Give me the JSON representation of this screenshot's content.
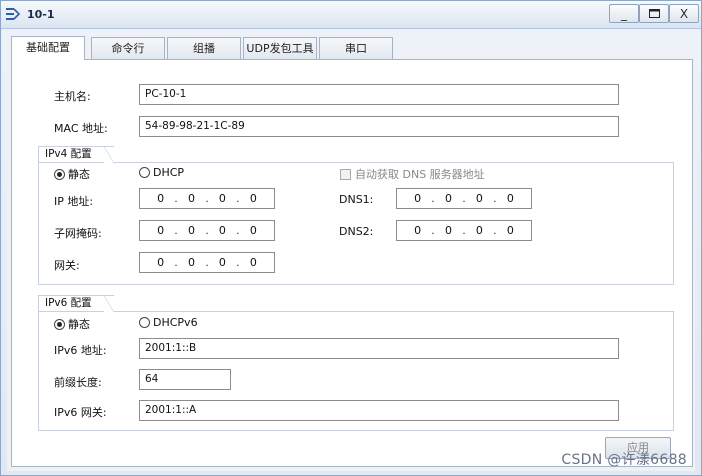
{
  "window": {
    "title": "10-1"
  },
  "tabs": [
    "基础配置",
    "命令行",
    "组播",
    "UDP发包工具",
    "串口"
  ],
  "basic": {
    "hostname_label": "主机名:",
    "hostname_value": "PC-10-1",
    "mac_label": "MAC 地址:",
    "mac_value": "54-89-98-21-1C-89"
  },
  "ipv4": {
    "section_title": "IPv4 配置",
    "static_label": "静态",
    "dhcp_label": "DHCP",
    "auto_dns_label": "自动获取 DNS 服务器地址",
    "ip_label": "IP 地址:",
    "mask_label": "子网掩码:",
    "gateway_label": "网关:",
    "dns1_label": "DNS1:",
    "dns2_label": "DNS2:",
    "ip_octets": [
      "0",
      "0",
      "0",
      "0"
    ],
    "mask_octets": [
      "0",
      "0",
      "0",
      "0"
    ],
    "gateway_octets": [
      "0",
      "0",
      "0",
      "0"
    ],
    "dns1_octets": [
      "0",
      "0",
      "0",
      "0"
    ],
    "dns2_octets": [
      "0",
      "0",
      "0",
      "0"
    ],
    "static_selected": true,
    "auto_dns_checked": false
  },
  "ipv6": {
    "section_title": "IPv6 配置",
    "static_label": "静态",
    "dhcp_label": "DHCPv6",
    "addr_label": "IPv6 地址:",
    "addr_value": "2001:1::B",
    "prefix_label": "前缀长度:",
    "prefix_value": "64",
    "gateway_label": "IPv6 网关:",
    "gateway_value": "2001:1::A",
    "static_selected": true
  },
  "apply_label": "应用",
  "watermark": "CSDN @许漾6688",
  "colors": {
    "window_bg": "#dde6f1",
    "panel_bg": "#ffffff",
    "border": "#a7b4c6"
  }
}
